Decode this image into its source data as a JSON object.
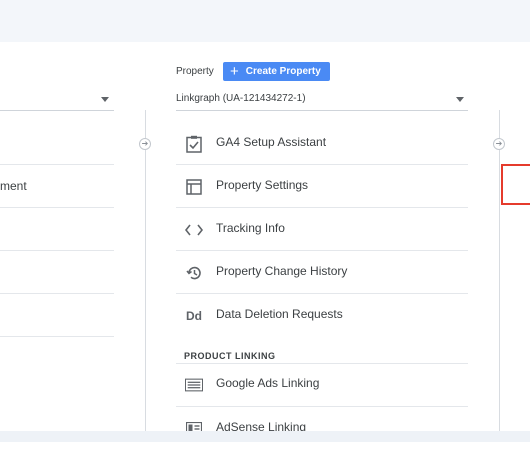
{
  "left_column": {
    "partial_item": "ment"
  },
  "property": {
    "label": "Property",
    "create_button": "Create Property",
    "selected": "Linkgraph (UA-121434272-1)"
  },
  "menu": {
    "items": [
      {
        "label": "GA4 Setup Assistant",
        "icon": "checklist-icon"
      },
      {
        "label": "Property Settings",
        "icon": "property-settings-icon"
      },
      {
        "label": "Tracking Info",
        "icon": "code-brackets-icon"
      },
      {
        "label": "Property Change History",
        "icon": "history-icon"
      },
      {
        "label": "Data Deletion Requests",
        "icon": "dd-icon"
      }
    ],
    "section_header": "PRODUCT LINKING",
    "linking_items": [
      {
        "label": "Google Ads Linking",
        "icon": "google-ads-icon"
      },
      {
        "label": "AdSense Linking",
        "icon": "adsense-icon"
      }
    ],
    "dd_icon_text": "Dd"
  },
  "colors": {
    "accent_button": "#4a8af4",
    "highlight_box": "#e53b2c"
  }
}
